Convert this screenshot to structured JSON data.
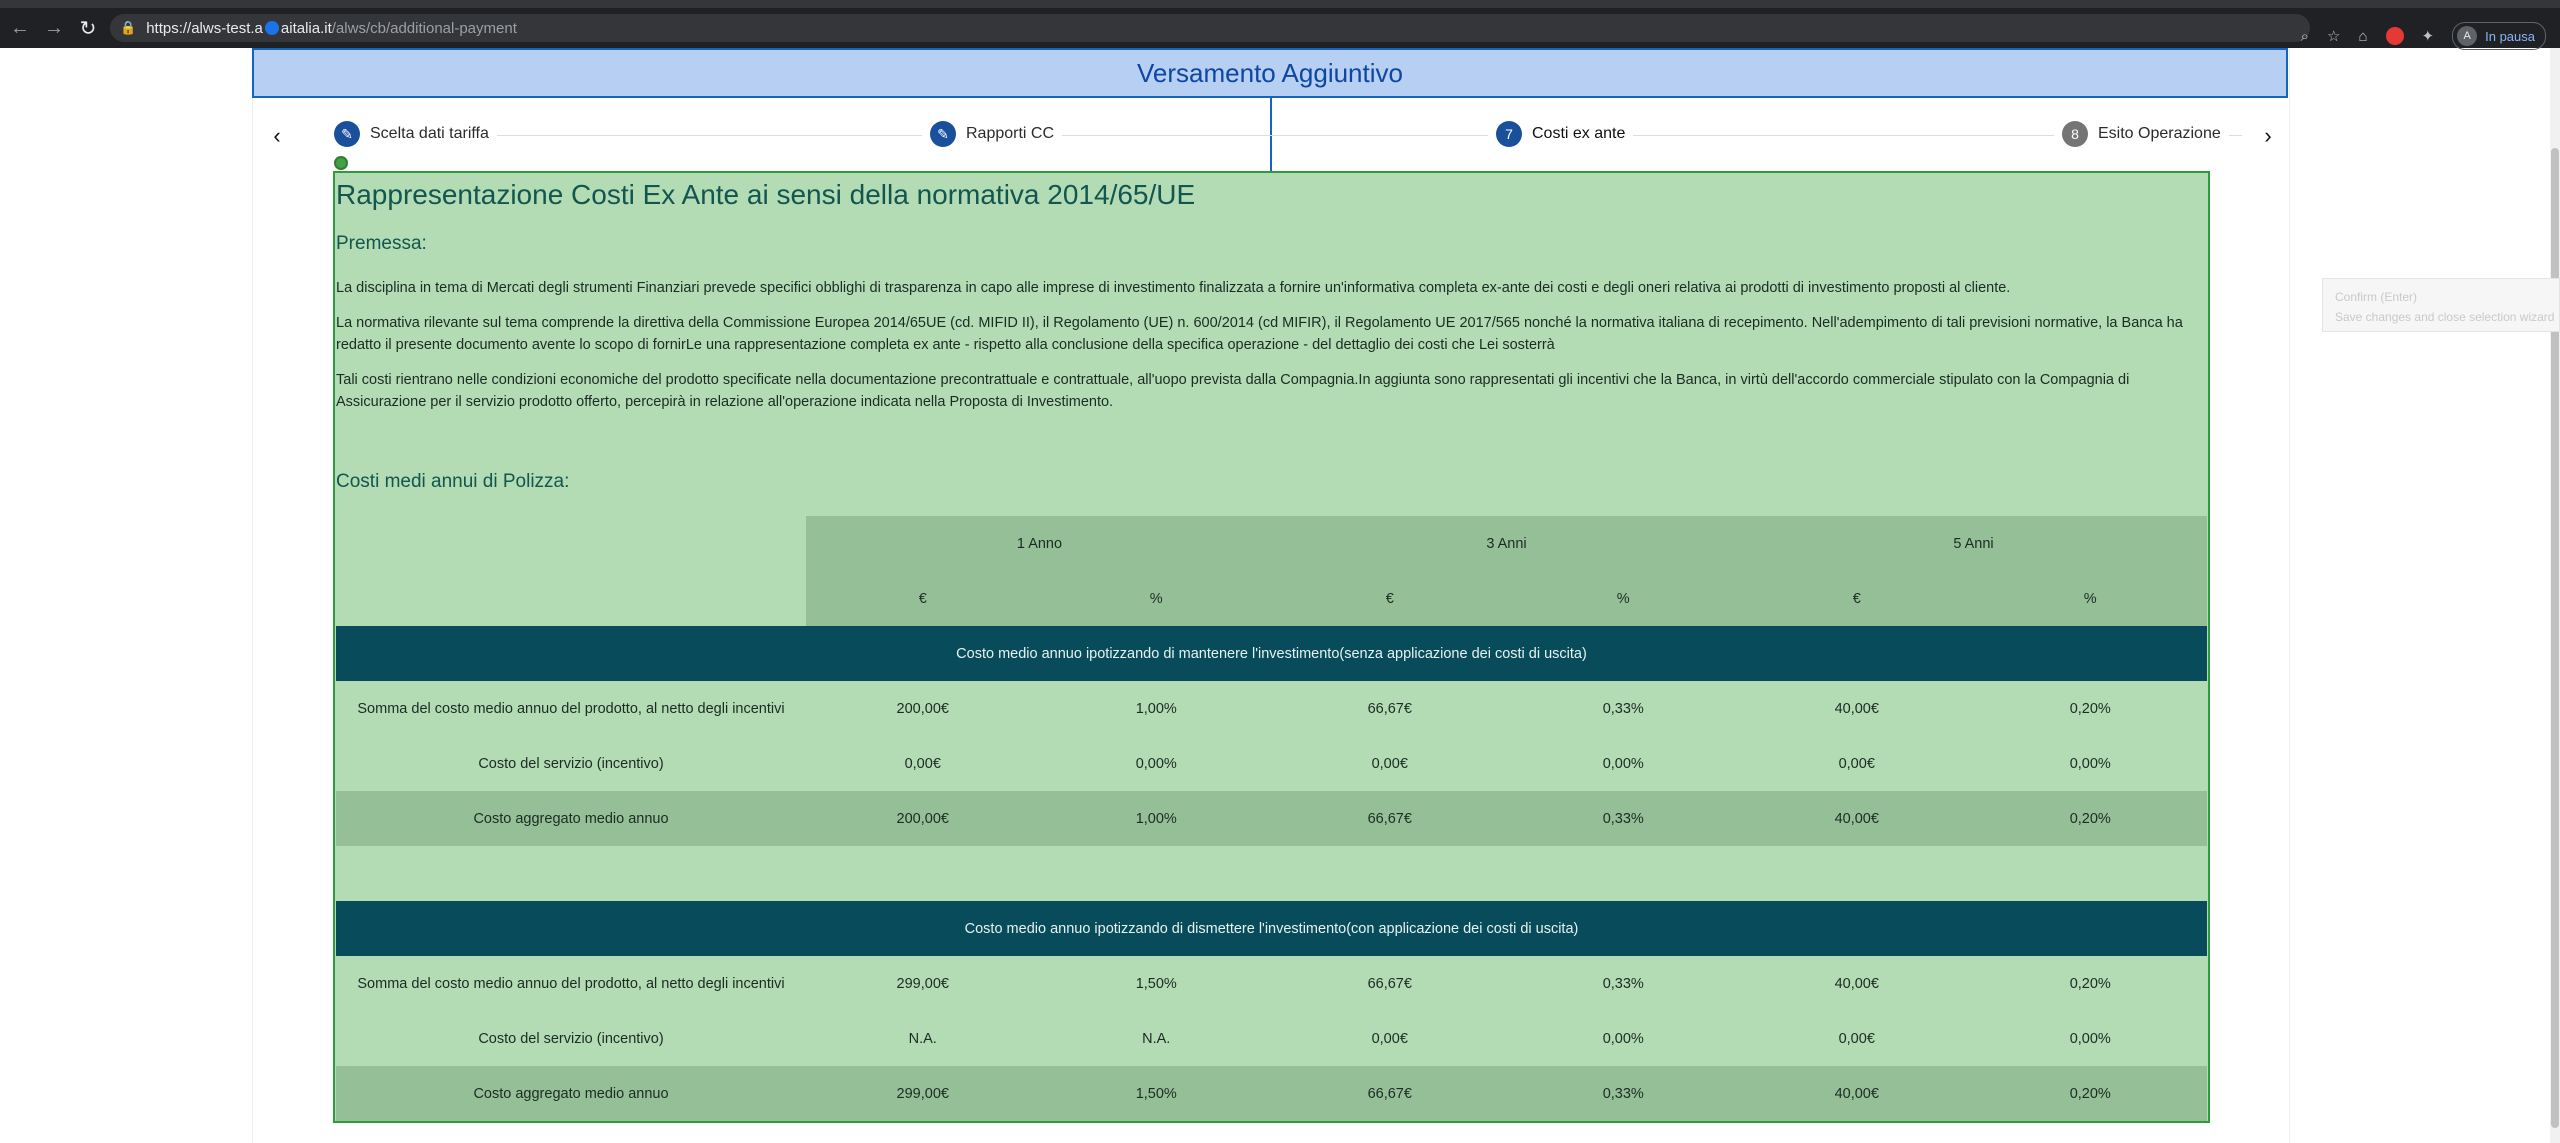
{
  "browser": {
    "url_main": "https://alws-test.a",
    "url_domain": "aitalia.it",
    "url_path": "/alws/cb/additional-payment",
    "profile_initial": "A",
    "profile_status": "In pausa"
  },
  "page": {
    "title": "Versamento Aggiuntivo"
  },
  "stepper": {
    "steps": [
      {
        "label": "Scelta dati tariffa",
        "icon": "pencil-icon",
        "badge": ""
      },
      {
        "label": "Rapporti CC",
        "icon": "pencil-icon",
        "badge": ""
      },
      {
        "label": "Costi ex ante",
        "icon": "",
        "badge": "7"
      },
      {
        "label": "Esito Operazione",
        "icon": "",
        "badge": "8"
      }
    ]
  },
  "content": {
    "title": "Rappresentazione Costi Ex Ante ai sensi della normativa 2014/65/UE",
    "premessa": "Premessa:",
    "paragraph1": "La disciplina in tema di Mercati degli strumenti Finanziari prevede specifici obblighi di trasparenza in capo alle imprese di investimento finalizzata a fornire un'informativa completa ex-ante dei costi e degli oneri relativa ai prodotti di investimento proposti al cliente.",
    "paragraph2": "La normativa rilevante sul tema comprende la direttiva della Commissione Europea 2014/65UE (cd. MIFID II), il Regolamento (UE) n. 600/2014 (cd MIFIR), il Regolamento UE 2017/565 nonché la normativa italiana di recepimento. Nell'adempimento di tali previsioni normative, la Banca ha redatto il presente documento avente lo scopo di fornirLe una rappresentazione completa ex ante - rispetto alla conclusione della specifica operazione - del dettaglio dei costi che Lei sosterrà",
    "paragraph3": "Tali costi rientrano nelle condizioni economiche del prodotto specificate nella documentazione precontrattuale e contrattuale, all'uopo prevista dalla Compagnia.In aggiunta sono rappresentati gli incentivi che la Banca, in virtù dell'accordo commerciale stipulato con la Compagnia di Assicurazione per il servizio prodotto offerto, percepirà in relazione all'operazione indicata nella Proposta di Investimento.",
    "costi_title": "Costi medi annui di Polizza:"
  },
  "table": {
    "periods": [
      "1 Anno",
      "3 Anni",
      "5 Anni"
    ],
    "units": [
      "€",
      "%",
      "€",
      "%",
      "€",
      "%"
    ],
    "sections": [
      {
        "header": "Costo medio annuo ipotizzando di mantenere l'investimento(senza applicazione dei costi di uscita)",
        "rows": [
          {
            "label": "Somma del costo medio annuo del prodotto, al netto degli incentivi",
            "values": [
              "200,00€",
              "1,00%",
              "66,67€",
              "0,33%",
              "40,00€",
              "0,20%"
            ]
          },
          {
            "label": "Costo del servizio (incentivo)",
            "values": [
              "0,00€",
              "0,00%",
              "0,00€",
              "0,00%",
              "0,00€",
              "0,00%"
            ]
          },
          {
            "label": "Costo aggregato medio annuo",
            "values": [
              "200,00€",
              "1,00%",
              "66,67€",
              "0,33%",
              "40,00€",
              "0,20%"
            ]
          }
        ]
      },
      {
        "header": "Costo medio annuo ipotizzando di dismettere l'investimento(con applicazione dei costi di uscita)",
        "rows": [
          {
            "label": "Somma del costo medio annuo del prodotto, al netto degli incentivi",
            "values": [
              "299,00€",
              "1,50%",
              "66,67€",
              "0,33%",
              "40,00€",
              "0,20%"
            ]
          },
          {
            "label": "Costo del servizio (incentivo)",
            "values": [
              "N.A.",
              "N.A.",
              "0,00€",
              "0,00%",
              "0,00€",
              "0,00%"
            ]
          },
          {
            "label": "Costo aggregato medio annuo",
            "values": [
              "299,00€",
              "1,50%",
              "66,67€",
              "0,33%",
              "40,00€",
              "0,20%"
            ]
          }
        ]
      }
    ]
  },
  "overlay": {
    "confirm_title": "Confirm (Enter)",
    "confirm_desc": "Save changes and close selection wizard"
  },
  "colors": {
    "title_bar_bg": "#b6cff2",
    "panel_bg": "#b3dcb4",
    "section_header_bg": "#084c5b",
    "stepper_badge": "#1a4f9c"
  }
}
